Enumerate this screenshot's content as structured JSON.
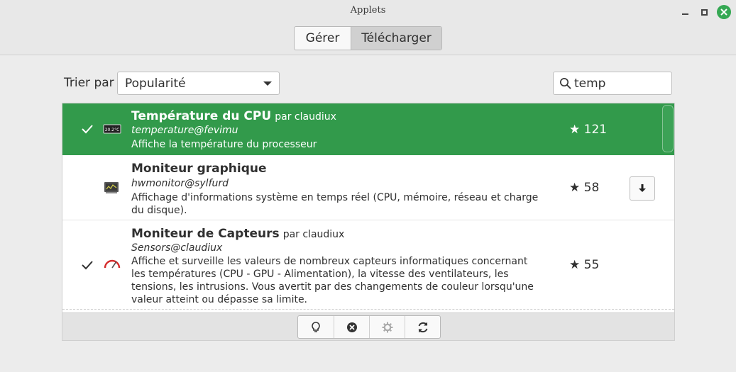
{
  "window": {
    "title": "Applets"
  },
  "tabs": [
    {
      "label": "Gérer",
      "active": false
    },
    {
      "label": "Télécharger",
      "active": true
    }
  ],
  "sort": {
    "label": "Trier par",
    "value": "Popularité"
  },
  "search": {
    "value": "temp",
    "icon": "search-icon"
  },
  "applets": [
    {
      "name": "Température du CPU",
      "author": "par claudiux",
      "uuid": "temperature@fevimu",
      "description": "Affiche la température du processeur",
      "stars": "★ 121",
      "installed": true,
      "selected": true,
      "icon": "cpu-temperature-icon"
    },
    {
      "name": "Moniteur graphique",
      "author": "",
      "uuid": "hwmonitor@sylfurd",
      "description": "Affichage d'informations système en temps réel (CPU, mémoire, réseau et charge du disque).",
      "stars": "★ 58",
      "installed": false,
      "selected": false,
      "icon": "monitor-icon"
    },
    {
      "name": "Moniteur de Capteurs",
      "author": "par claudiux",
      "uuid": "Sensors@claudiux",
      "description": "Affiche et surveille les valeurs de nombreux capteurs informatiques concernant les températures (CPU - GPU - Alimentation), la vitesse des ventilateurs, les tensions, les intrusions. Vous avertit par des changements de couleur lorsqu'une valeur atteint ou dépasse sa limite.",
      "stars": "★ 55",
      "installed": true,
      "selected": false,
      "icon": "gauge-icon"
    }
  ],
  "toolbar": [
    "lightbulb-icon",
    "remove-icon",
    "gear-icon",
    "refresh-icon"
  ],
  "colors": {
    "selection": "#329a4b",
    "close_button": "#35a853"
  }
}
